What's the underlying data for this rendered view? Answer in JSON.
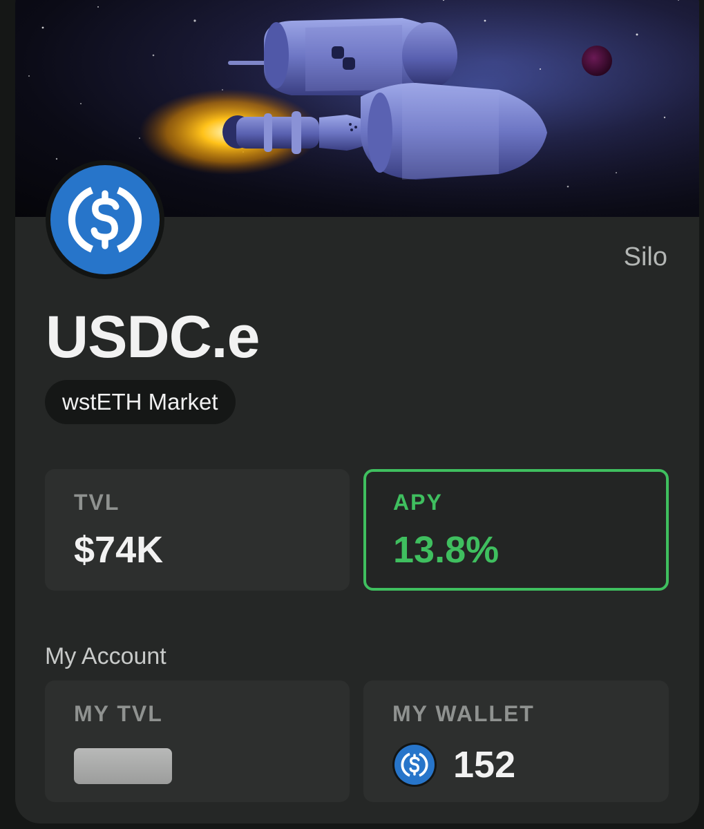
{
  "card": {
    "protocol": "Silo",
    "token": "USDC.e",
    "market": "wstETH Market",
    "token_icon": "usdc-icon",
    "stats": {
      "tvl": {
        "label": "TVL",
        "value": "$74K"
      },
      "apy": {
        "label": "APY",
        "value": "13.8%"
      }
    },
    "account": {
      "title": "My Account",
      "my_tvl": {
        "label": "MY TVL",
        "value_hidden": true
      },
      "my_wallet": {
        "label": "MY WALLET",
        "value": "152",
        "icon": "usdc-icon"
      }
    }
  },
  "colors": {
    "card_bg": "#252726",
    "stat_bg": "#2d2f2e",
    "apy_accent": "#3fbf5f",
    "usdc_blue": "#2775ca"
  }
}
